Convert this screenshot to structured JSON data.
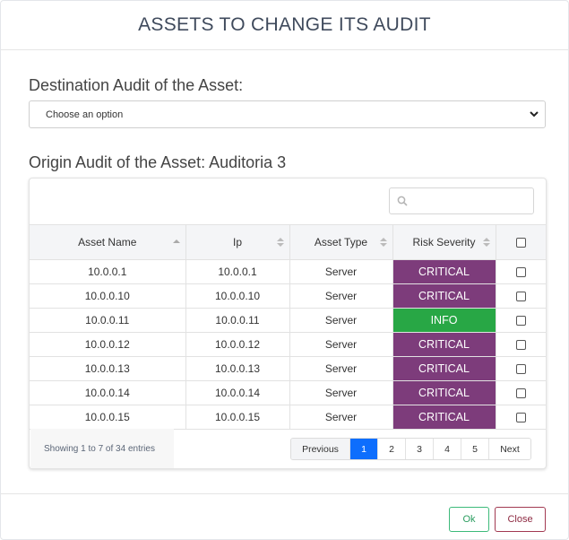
{
  "modal": {
    "title": "ASSETS TO CHANGE ITS AUDIT"
  },
  "destination": {
    "label": "Destination Audit of the Asset:",
    "select_value": "Choose an option"
  },
  "origin": {
    "label": "Origin Audit of the Asset: Auditoria 3"
  },
  "search": {
    "placeholder": "",
    "icon": "search-icon"
  },
  "table": {
    "headers": [
      "Asset Name",
      "Ip",
      "Asset Type",
      "Risk Severity"
    ],
    "rows": [
      {
        "name": "10.0.0.1",
        "ip": "10.0.0.1",
        "type": "Server",
        "severity": "CRITICAL"
      },
      {
        "name": "10.0.0.10",
        "ip": "10.0.0.10",
        "type": "Server",
        "severity": "CRITICAL"
      },
      {
        "name": "10.0.0.11",
        "ip": "10.0.0.11",
        "type": "Server",
        "severity": "INFO"
      },
      {
        "name": "10.0.0.12",
        "ip": "10.0.0.12",
        "type": "Server",
        "severity": "CRITICAL"
      },
      {
        "name": "10.0.0.13",
        "ip": "10.0.0.13",
        "type": "Server",
        "severity": "CRITICAL"
      },
      {
        "name": "10.0.0.14",
        "ip": "10.0.0.14",
        "type": "Server",
        "severity": "CRITICAL"
      },
      {
        "name": "10.0.0.15",
        "ip": "10.0.0.15",
        "type": "Server",
        "severity": "CRITICAL"
      }
    ]
  },
  "severity_colors": {
    "CRITICAL": "#7d3c7b",
    "INFO": "#28a745"
  },
  "info": {
    "showing": "Showing 1 to 7 of 34 entries"
  },
  "pagination": {
    "previous": "Previous",
    "pages": [
      "1",
      "2",
      "3",
      "4",
      "5"
    ],
    "active_page": "1",
    "next": "Next"
  },
  "buttons": {
    "ok": "Ok",
    "close": "Close"
  },
  "colors": {
    "primary": "#0d6efd",
    "ok_border": "#3dba7a",
    "close_border": "#a23a52"
  }
}
